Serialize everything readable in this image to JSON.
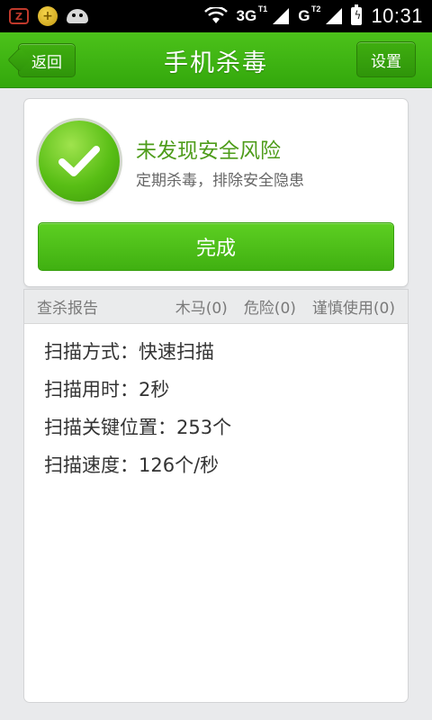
{
  "status_bar": {
    "notification_icons": [
      "zhangyue-z-icon",
      "plus-coin-icon",
      "android-icon"
    ],
    "network1": "3G",
    "network1_sub": "T1",
    "network2": "G",
    "network2_sub": "T2",
    "time": "10:31"
  },
  "title_bar": {
    "back_label": "返回",
    "title": "手机杀毒",
    "settings_label": "设置"
  },
  "result": {
    "title": "未发现安全风险",
    "subtitle": "定期杀毒，排除安全隐患",
    "done_label": "完成"
  },
  "report": {
    "header_title": "查杀报告",
    "trojan": "木马(0)",
    "danger": "危险(0)",
    "caution": "谨慎使用(0)",
    "lines": [
      "扫描方式：快速扫描",
      "扫描用时：2秒",
      "扫描关键位置：253个",
      "扫描速度：126个/秒"
    ]
  },
  "colors": {
    "brand_green": "#3fb013",
    "result_title_green": "#4e9c1a"
  }
}
